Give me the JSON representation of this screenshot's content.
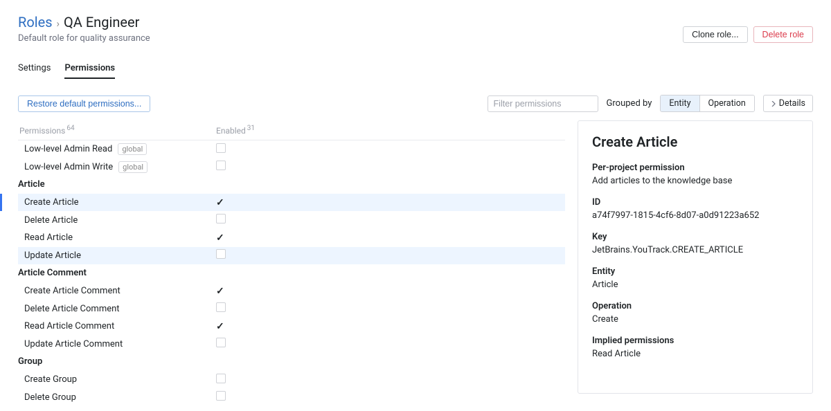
{
  "breadcrumb": {
    "root": "Roles",
    "current": "QA Engineer"
  },
  "subtitle": "Default role for quality assurance",
  "header_actions": {
    "clone": "Clone role...",
    "delete": "Delete role"
  },
  "tabs": {
    "settings": "Settings",
    "permissions": "Permissions"
  },
  "toolbar": {
    "restore": "Restore default permissions...",
    "filter_placeholder": "Filter permissions",
    "groupby_label": "Grouped by",
    "seg_entity": "Entity",
    "seg_operation": "Operation",
    "details": "Details"
  },
  "table": {
    "col_permissions": "Permissions",
    "count_permissions": "64",
    "col_enabled": "Enabled",
    "count_enabled": "31",
    "rows": [
      {
        "type": "item",
        "label": "Low-level Admin Read",
        "badge": "global",
        "checked": false
      },
      {
        "type": "item",
        "label": "Low-level Admin Write",
        "badge": "global",
        "checked": false
      },
      {
        "type": "group",
        "label": "Article"
      },
      {
        "type": "item",
        "label": "Create Article",
        "checked": true,
        "selected": true
      },
      {
        "type": "item",
        "label": "Delete Article",
        "checked": false
      },
      {
        "type": "item",
        "label": "Read Article",
        "checked": true
      },
      {
        "type": "item",
        "label": "Update Article",
        "checked": false,
        "highlight": true
      },
      {
        "type": "group",
        "label": "Article Comment"
      },
      {
        "type": "item",
        "label": "Create Article Comment",
        "checked": true
      },
      {
        "type": "item",
        "label": "Delete Article Comment",
        "checked": false
      },
      {
        "type": "item",
        "label": "Read Article Comment",
        "checked": true
      },
      {
        "type": "item",
        "label": "Update Article Comment",
        "checked": false
      },
      {
        "type": "group",
        "label": "Group"
      },
      {
        "type": "item",
        "label": "Create Group",
        "checked": false
      },
      {
        "type": "item",
        "label": "Delete Group",
        "checked": false
      }
    ]
  },
  "details": {
    "title": "Create Article",
    "scope_label": "Per-project permission",
    "description": "Add articles to the knowledge base",
    "id_label": "ID",
    "id_value": "a74f7997-1815-4cf6-8d07-a0d91223a652",
    "key_label": "Key",
    "key_value": "JetBrains.YouTrack.CREATE_ARTICLE",
    "entity_label": "Entity",
    "entity_value": "Article",
    "operation_label": "Operation",
    "operation_value": "Create",
    "implied_label": "Implied permissions",
    "implied_value": "Read Article"
  }
}
